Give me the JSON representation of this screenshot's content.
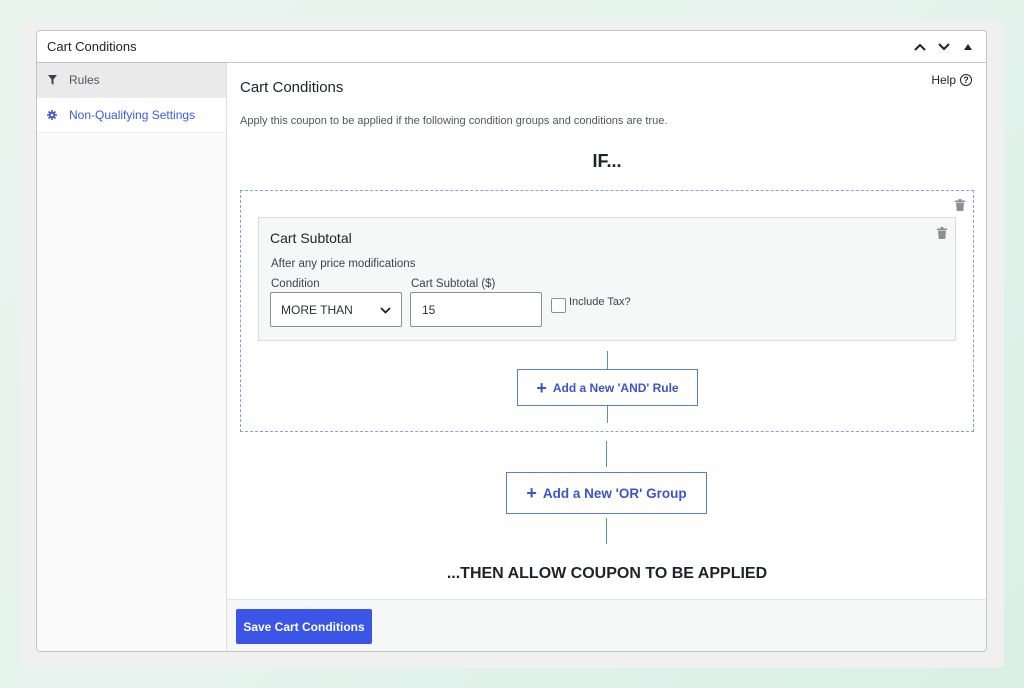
{
  "panel": {
    "title": "Cart Conditions"
  },
  "sidebar": {
    "items": [
      {
        "label": "Rules",
        "icon": "filter-icon"
      },
      {
        "label": "Non-Qualifying Settings",
        "icon": "gear-icon"
      }
    ]
  },
  "main": {
    "title": "Cart Conditions",
    "help_label": "Help",
    "description": "Apply this coupon to be applied if the following condition groups and conditions are true.",
    "if_label": "IF...",
    "then_label": "...THEN ALLOW COUPON TO BE APPLIED"
  },
  "rule": {
    "title": "Cart Subtotal",
    "subtitle": "After any price modifications",
    "condition_label": "Condition",
    "condition_value": "MORE THAN",
    "subtotal_label": "Cart Subtotal ($)",
    "subtotal_value": "15",
    "include_tax_label": "Include Tax?",
    "include_tax_checked": false
  },
  "buttons": {
    "add_and": "Add a New 'AND' Rule",
    "add_or": "Add a New 'OR' Group",
    "save": "Save Cart Conditions"
  },
  "colors": {
    "accent": "#3b55e6",
    "link": "#3b5bdb",
    "connector": "#5b8ec7"
  }
}
